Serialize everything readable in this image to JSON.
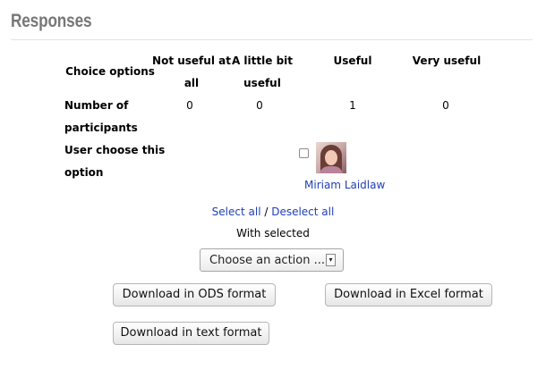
{
  "section": {
    "title": "Responses"
  },
  "table": {
    "header": {
      "first": "Choice options",
      "cols": [
        {
          "line1": "Not useful at",
          "line2": "all"
        },
        {
          "line1": "A little bit",
          "line2": "useful"
        },
        {
          "line1": "Useful",
          "line2": ""
        },
        {
          "line1": "Very useful",
          "line2": ""
        }
      ]
    },
    "participants_row": {
      "label_line1": "Number of",
      "label_line2": "participants",
      "values": [
        "0",
        "0",
        "1",
        "0"
      ]
    },
    "user_row": {
      "label_line1": "User choose this",
      "label_line2": "option",
      "user_name": "Miriam Laidlaw"
    }
  },
  "bulk": {
    "select_all": "Select all",
    "separator": " / ",
    "deselect_all": "Deselect all",
    "with_selected": "With selected",
    "action_value": "Choose an action ..."
  },
  "downloads": {
    "ods": "Download in ODS format",
    "excel": "Download in Excel format",
    "text": "Download in text format"
  }
}
